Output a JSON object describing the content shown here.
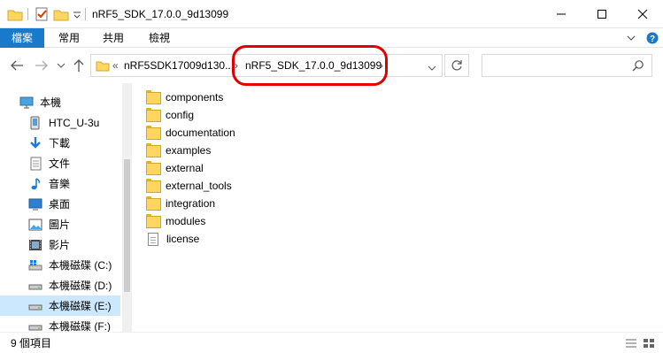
{
  "window": {
    "title": "nRF5_SDK_17.0.0_9d13099",
    "minimize": "—",
    "maximize": "☐",
    "close": "✕"
  },
  "ribbon": {
    "tabs": [
      "檔案",
      "常用",
      "共用",
      "檢視"
    ],
    "expand": "⌄",
    "help": "?"
  },
  "nav": {
    "back": "←",
    "forward": "→",
    "recent": "⌄",
    "up": "↑",
    "dropdown": "⌄",
    "refresh": "↻",
    "search_icon": "⌕"
  },
  "address": {
    "overflow": "«",
    "segment_1": "nRF5SDK17009d130...",
    "separator_1": "›",
    "segment_2": "nRF5_SDK_17.0.0_9d13099",
    "separator_2": "›",
    "search_placeholder": ""
  },
  "sidebar": {
    "items": [
      {
        "label": "本機",
        "icon": "computer-icon"
      },
      {
        "label": "HTC_U-3u",
        "icon": "phone-icon"
      },
      {
        "label": "下載",
        "icon": "download-icon"
      },
      {
        "label": "文件",
        "icon": "document-icon"
      },
      {
        "label": "音樂",
        "icon": "music-icon"
      },
      {
        "label": "桌面",
        "icon": "desktop-icon"
      },
      {
        "label": "圖片",
        "icon": "pictures-icon"
      },
      {
        "label": "影片",
        "icon": "video-icon"
      },
      {
        "label": "本機磁碟 (C:)",
        "icon": "windows-drive-icon"
      },
      {
        "label": "本機磁碟 (D:)",
        "icon": "drive-icon"
      },
      {
        "label": "本機磁碟 (E:)",
        "icon": "drive-icon"
      },
      {
        "label": "本機磁碟 (F:)",
        "icon": "drive-icon"
      }
    ],
    "selected_index": 10
  },
  "files": [
    {
      "name": "components",
      "type": "folder"
    },
    {
      "name": "config",
      "type": "folder"
    },
    {
      "name": "documentation",
      "type": "folder"
    },
    {
      "name": "examples",
      "type": "folder"
    },
    {
      "name": "external",
      "type": "folder"
    },
    {
      "name": "external_tools",
      "type": "folder"
    },
    {
      "name": "integration",
      "type": "folder"
    },
    {
      "name": "modules",
      "type": "folder"
    },
    {
      "name": "license",
      "type": "file"
    }
  ],
  "status": {
    "item_count": "9 個項目"
  },
  "colors": {
    "accent": "#1979ca",
    "selection": "#cce8ff",
    "folder": "#ffd760",
    "annotation": "#e00000"
  }
}
